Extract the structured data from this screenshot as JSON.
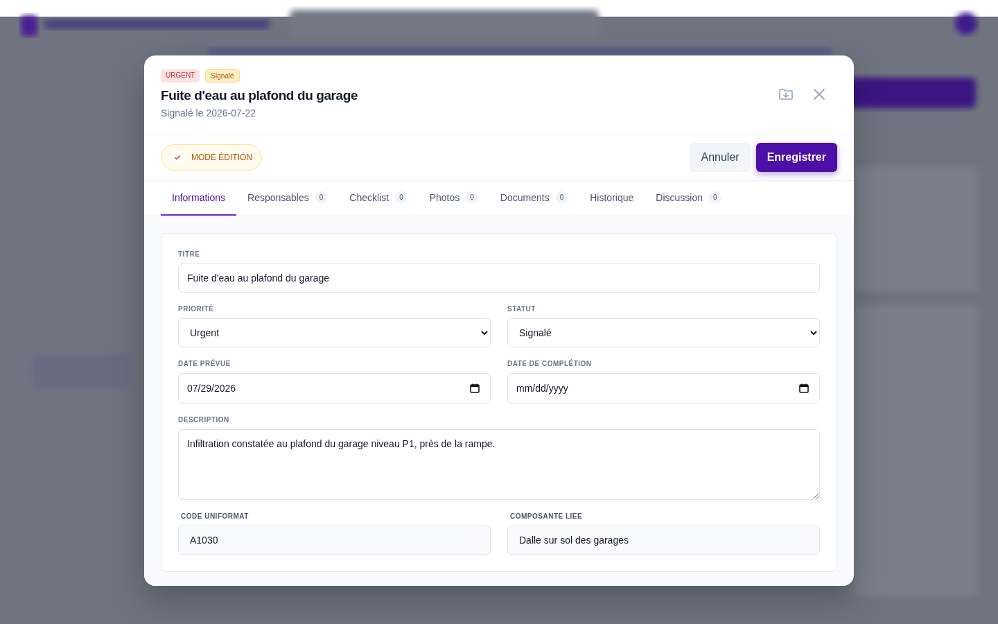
{
  "modal": {
    "badges": [
      {
        "label": "URGENT",
        "kind": "priority"
      },
      {
        "label": "Signalé",
        "kind": "status"
      }
    ],
    "title": "Fuite d'eau au plafond du garage",
    "subtitle": "Signalé le 2026-07-22",
    "edit_mode": {
      "label": "MODE ÉDITION",
      "on": true
    },
    "buttons": [
      {
        "label": "Annuler",
        "kind": "secondary"
      },
      {
        "label": "Enregistrer",
        "kind": "primary"
      }
    ],
    "tabs": [
      {
        "label": "Informations",
        "selected": true
      },
      {
        "label": "Responsables",
        "count": "0",
        "selected": false
      },
      {
        "label": "Checklist",
        "count": "0",
        "selected": false
      },
      {
        "label": "Photos",
        "count": "0",
        "selected": false
      },
      {
        "label": "Documents",
        "count": "0",
        "selected": false
      },
      {
        "label": "Historique",
        "selected": false
      },
      {
        "label": "Discussion",
        "count": "0",
        "selected": false
      }
    ],
    "form": {
      "rows": [
        [
          {
            "label": "TITRE",
            "kind": "text",
            "value": "Fuite d'eau au plafond du garage",
            "readonly": false
          }
        ],
        [
          {
            "label": "PRIORITÉ",
            "kind": "select",
            "value": "Urgent",
            "readonly": false
          },
          {
            "label": "STATUT",
            "kind": "select",
            "value": "Signalé",
            "readonly": false
          }
        ],
        [
          {
            "label": "DATE PRÉVUE",
            "kind": "date",
            "value": "07/29/2026",
            "readonly": false
          },
          {
            "label": "DATE DE COMPLÉTION",
            "kind": "date",
            "placeholder": "mm/dd/yyyy",
            "readonly": false
          }
        ],
        [
          {
            "label": "DESCRIPTION",
            "kind": "textarea",
            "value": "Infiltration constatée au plafond du garage niveau P1, près de la rampe.",
            "readonly": false
          }
        ],
        [
          {
            "label": "CODE UNIFORMAT",
            "kind": "text",
            "value": "A1030",
            "readonly": true
          },
          {
            "label": "COMPOSANTE LIEE",
            "kind": "text",
            "value": "Dalle sur sol des garages",
            "readonly": true
          }
        ]
      ]
    }
  }
}
